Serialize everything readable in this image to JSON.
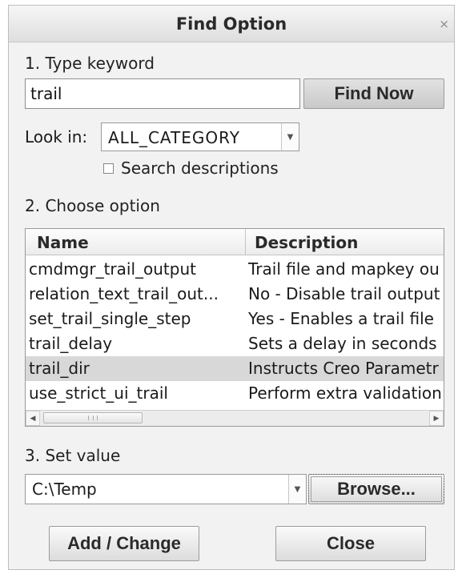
{
  "dialog": {
    "title": "Find Option",
    "close_glyph": "×"
  },
  "step1": {
    "label": "1.  Type keyword",
    "keyword_value": "trail",
    "find_button": "Find Now",
    "look_in_label": "Look in:",
    "look_in_value": "ALL_CATEGORY",
    "search_descriptions_label": "Search descriptions",
    "search_descriptions_checked": false
  },
  "step2": {
    "label": "2.  Choose option",
    "columns": [
      "Name",
      "Description"
    ],
    "rows": [
      {
        "name": "cmdmgr_trail_output",
        "description": "Trail file and mapkey ou"
      },
      {
        "name": "relation_text_trail_out...",
        "description": "No - Disable trail output"
      },
      {
        "name": "set_trail_single_step",
        "description": "Yes - Enables a trail file"
      },
      {
        "name": "trail_delay",
        "description": "Sets a delay in seconds"
      },
      {
        "name": "trail_dir",
        "description": "Instructs Creo Parametr"
      },
      {
        "name": "use_strict_ui_trail",
        "description": "Perform extra validation"
      }
    ],
    "selected_row": 4
  },
  "step3": {
    "label": "3.  Set value",
    "value": "C:\\Temp",
    "browse_button": "Browse..."
  },
  "footer": {
    "add_change_button": "Add / Change",
    "close_button": "Close"
  },
  "icons": {
    "dropdown": "chevron-down-icon",
    "scroll_left": "arrow-left-icon",
    "scroll_right": "arrow-right-icon",
    "close": "close-icon"
  }
}
